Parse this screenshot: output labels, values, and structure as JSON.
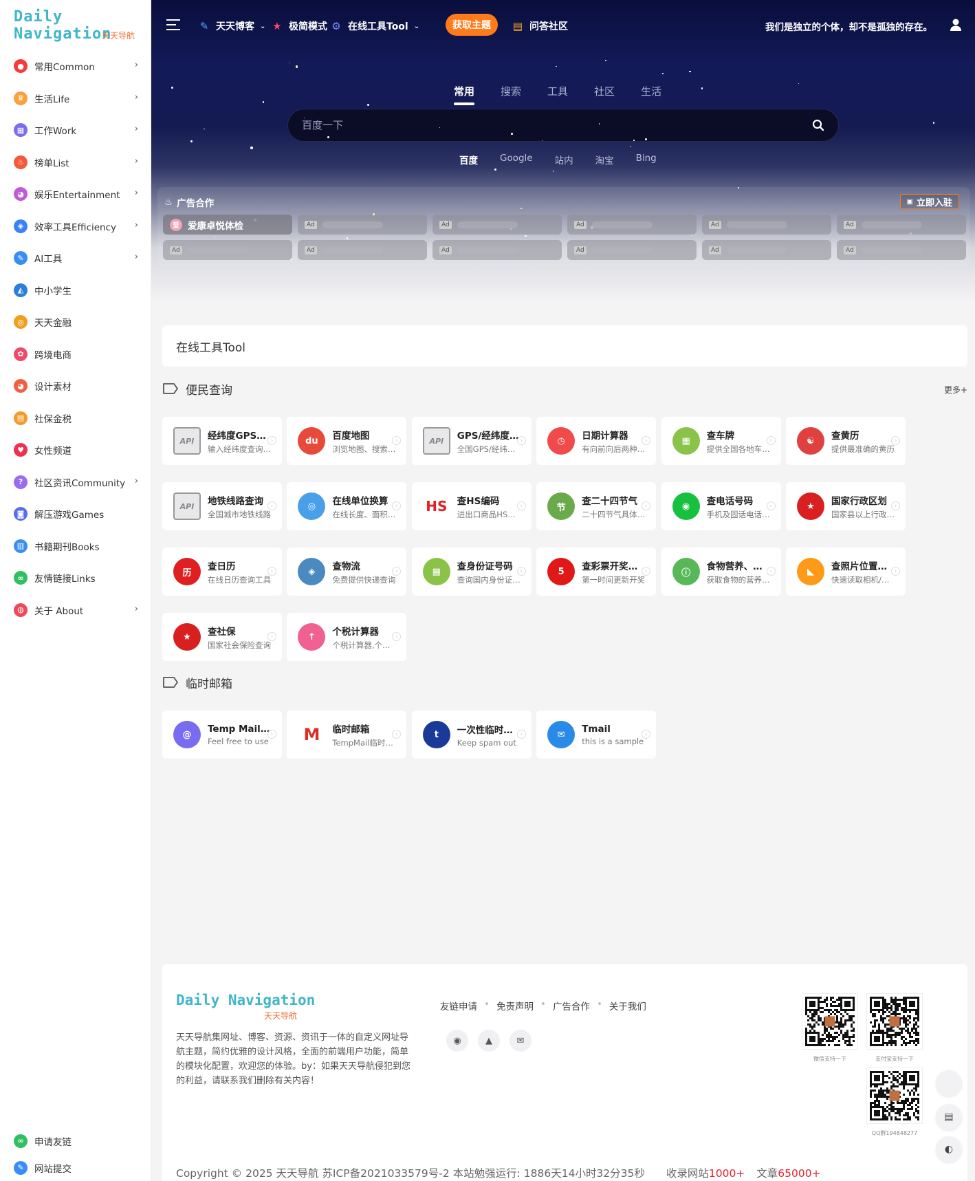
{
  "logo": {
    "en": "Daily Navigation",
    "cn": "天天导航"
  },
  "sidebar": {
    "items": [
      {
        "label": "常用Common",
        "icon": "thumb-up-icon",
        "color": "#f53b3b",
        "arrow": true
      },
      {
        "label": "生活Life",
        "icon": "crown-icon",
        "color": "#f7a23b",
        "arrow": true
      },
      {
        "label": "工作Work",
        "icon": "grid-icon",
        "color": "#7c6cf0",
        "arrow": true
      },
      {
        "label": "榜单List",
        "icon": "fire-icon",
        "color": "#f25a3a",
        "arrow": true
      },
      {
        "label": "娱乐Entertainment",
        "icon": "palette-icon",
        "color": "#c05ad6",
        "arrow": true
      },
      {
        "label": "效率工具Efficiency",
        "icon": "cube-icon",
        "color": "#3b82f6",
        "arrow": true
      },
      {
        "label": "AI工具",
        "icon": "edit-icon",
        "color": "#3b8df6",
        "arrow": true
      },
      {
        "label": "中小学生",
        "icon": "graduation-cap-icon",
        "color": "#2a7fd8",
        "arrow": false
      },
      {
        "label": "天天金融",
        "icon": "coins-icon",
        "color": "#f0a020",
        "arrow": false
      },
      {
        "label": "跨境电商",
        "icon": "flower-icon",
        "color": "#f04a6a",
        "arrow": false
      },
      {
        "label": "设计素材",
        "icon": "palette-icon",
        "color": "#f06040",
        "arrow": false
      },
      {
        "label": "社保金税",
        "icon": "chat-icon",
        "color": "#f59a2a",
        "arrow": false
      },
      {
        "label": "女性频道",
        "icon": "heart-icon",
        "color": "#f03050",
        "arrow": false
      },
      {
        "label": "社区资讯Community",
        "icon": "question-icon",
        "color": "#9a6cf0",
        "arrow": true
      },
      {
        "label": "解压游戏Games",
        "icon": "gamepad-icon",
        "color": "#5a6cf0",
        "arrow": false
      },
      {
        "label": "书籍期刊Books",
        "icon": "book-icon",
        "color": "#3b8df6",
        "arrow": false
      },
      {
        "label": "友情链接Links",
        "icon": "link-icon",
        "color": "#30c060",
        "arrow": false
      },
      {
        "label": "关于 About",
        "icon": "users-icon",
        "color": "#f04a5a",
        "arrow": true
      }
    ],
    "bottom": [
      {
        "label": "申请友链",
        "icon": "link-icon",
        "color": "#30c060"
      },
      {
        "label": "网站提交",
        "icon": "edit-icon",
        "color": "#3b8df6"
      }
    ]
  },
  "topnav": {
    "items": [
      {
        "label": "天天博客",
        "icon": "edit-icon",
        "dropdown": true
      },
      {
        "label": "极简模式",
        "icon": "star-icon",
        "dropdown": false
      },
      {
        "label": "在线工具Tool",
        "icon": "gear-icon",
        "dropdown": true
      },
      {
        "label": "问答社区",
        "icon": "chat-icon",
        "dropdown": false
      }
    ],
    "get_theme": "获取主题",
    "motto": "我们是独立的个体，却不是孤独的存在。"
  },
  "search": {
    "tabs": [
      "常用",
      "搜索",
      "工具",
      "社区",
      "生活"
    ],
    "active_tab": 0,
    "placeholder": "百度一下",
    "engines": [
      "百度",
      "Google",
      "站内",
      "淘宝",
      "Bing"
    ],
    "active_engine": 0
  },
  "ads": {
    "title": "广告合作",
    "join": "立即入驻",
    "first": {
      "label": "爱康卓悦体检",
      "avatar": "爱"
    },
    "placeholder_tag": "Ad"
  },
  "section_title": "在线工具Tool",
  "groups": [
    {
      "title": "便民查询",
      "more": "更多+",
      "cards": [
        {
          "title": "经纬度GPS查询",
          "desc": "输入经纬度查询位置",
          "icon": "api-icon",
          "color": "#e8e8ea",
          "text": "API"
        },
        {
          "title": "百度地图",
          "desc": "浏览地图、搜索地点",
          "icon": "map-pin-icon",
          "color": "#e84a3a",
          "text": "du"
        },
        {
          "title": "GPS/经纬度查询",
          "desc": "全国GPS/经纬度查询",
          "icon": "api-icon",
          "color": "#e8e8ea",
          "text": "API"
        },
        {
          "title": "日期计算器",
          "desc": "有向前向后两种计算",
          "icon": "clock-icon",
          "color": "#f04a4a",
          "text": "◷"
        },
        {
          "title": "查车牌",
          "desc": "提供全国各地车牌查询",
          "icon": "image-icon",
          "color": "#8bc34a",
          "text": "▦"
        },
        {
          "title": "查黄历",
          "desc": "提供最准确的黄历",
          "icon": "yin-yang-icon",
          "color": "#e04040",
          "text": "☯"
        },
        {
          "title": "地铁线路查询",
          "desc": "全国城市地铁线路",
          "icon": "api-icon",
          "color": "#e8e8ea",
          "text": "API"
        },
        {
          "title": "在线单位换算",
          "desc": "在线长度、面积换算",
          "icon": "monkey-icon",
          "color": "#4aa0e8",
          "text": "◎"
        },
        {
          "title": "查HS编码",
          "desc": "进出口商品HS编码",
          "icon": "hs-icon",
          "color": "#ffffff",
          "text": "HS"
        },
        {
          "title": "查二十四节气",
          "desc": "二十四节气具体时间",
          "icon": "landscape-icon",
          "color": "#6aaa4a",
          "text": "节"
        },
        {
          "title": "查电话号码",
          "desc": "手机及固话电话归属",
          "icon": "ring-icon",
          "color": "#18c040",
          "text": "◉"
        },
        {
          "title": "国家行政区划",
          "desc": "国家县以上行政区划",
          "icon": "emblem-icon",
          "color": "#d82020",
          "text": "★"
        },
        {
          "title": "查日历",
          "desc": "在线日历查询工具",
          "icon": "calendar-icon",
          "color": "#e02020",
          "text": "历"
        },
        {
          "title": "查物流",
          "desc": "免费提供快递查询",
          "icon": "box-icon",
          "color": "#4a8ac0",
          "text": "◈"
        },
        {
          "title": "查身份证号码",
          "desc": "查询国内身份证号码",
          "icon": "image-icon",
          "color": "#8bc34a",
          "text": "▦"
        },
        {
          "title": "查彩票开奖结果",
          "desc": "第一时间更新开奖",
          "icon": "lottery-icon",
          "color": "#e01818",
          "text": "5"
        },
        {
          "title": "食物营养、热量",
          "desc": "获取食物的营养成分",
          "icon": "info-icon",
          "color": "#58b858",
          "text": "ⓘ"
        },
        {
          "title": "查照片位置信息",
          "desc": "快速读取相机/照片",
          "icon": "photo-location-icon",
          "color": "#ff9a18",
          "text": "◣"
        },
        {
          "title": "查社保",
          "desc": "国家社会保险查询",
          "icon": "emblem-icon",
          "color": "#d82020",
          "text": "★"
        },
        {
          "title": "个税计算器",
          "desc": "个税计算器,个税查询",
          "icon": "arrow-up-icon",
          "color": "#f06090",
          "text": "↑"
        }
      ]
    },
    {
      "title": "临时邮箱",
      "more": "",
      "cards": [
        {
          "title": "Temp Mail - Disposable",
          "desc": "Feel free to use",
          "icon": "at-icon",
          "color": "#7a6cf0",
          "text": "@"
        },
        {
          "title": "临时邮箱",
          "desc": "TempMail临时邮箱",
          "icon": "gmail-icon",
          "color": "#ffffff",
          "text": "M"
        },
        {
          "title": "一次性临时邮箱",
          "desc": "Keep spam out",
          "icon": "t-icon",
          "color": "#1a3a9a",
          "text": "t"
        },
        {
          "title": "Tmail",
          "desc": "this is a sample",
          "icon": "mail-icon",
          "color": "#2a8ae8",
          "text": "✉"
        }
      ]
    }
  ],
  "footer": {
    "logo_en": "Daily Navigation",
    "logo_cn": "天天导航",
    "desc": "天天导航集网址、博客、资源、资讯于一体的自定义网址导航主题，简约优雅的设计风格，全面的前端用户功能，简单的模块化配置，欢迎您的体验。by：如果天天导航侵犯到您的利益，请联系我们删除有关内容！",
    "links": [
      "友链申请",
      "免责声明",
      "广告合作",
      "关于我们"
    ],
    "qr_captions": [
      "微信支持一下",
      "支付宝支持一下",
      "QQ群194848277"
    ],
    "copyright": "Copyright © 2025 天天导航 苏ICP备2021033579号-2 本站勉强运行: 1886天14小时32分35秒",
    "stat_sites_label": "收录网站",
    "stat_sites": "1000+",
    "stat_articles_label": "文章",
    "stat_articles": "65000+"
  },
  "colors": {
    "accent": "#ff7a1a",
    "brand": "#3fb6c9",
    "hero_dark": "#131a58",
    "stat_red": "#e5202b"
  }
}
